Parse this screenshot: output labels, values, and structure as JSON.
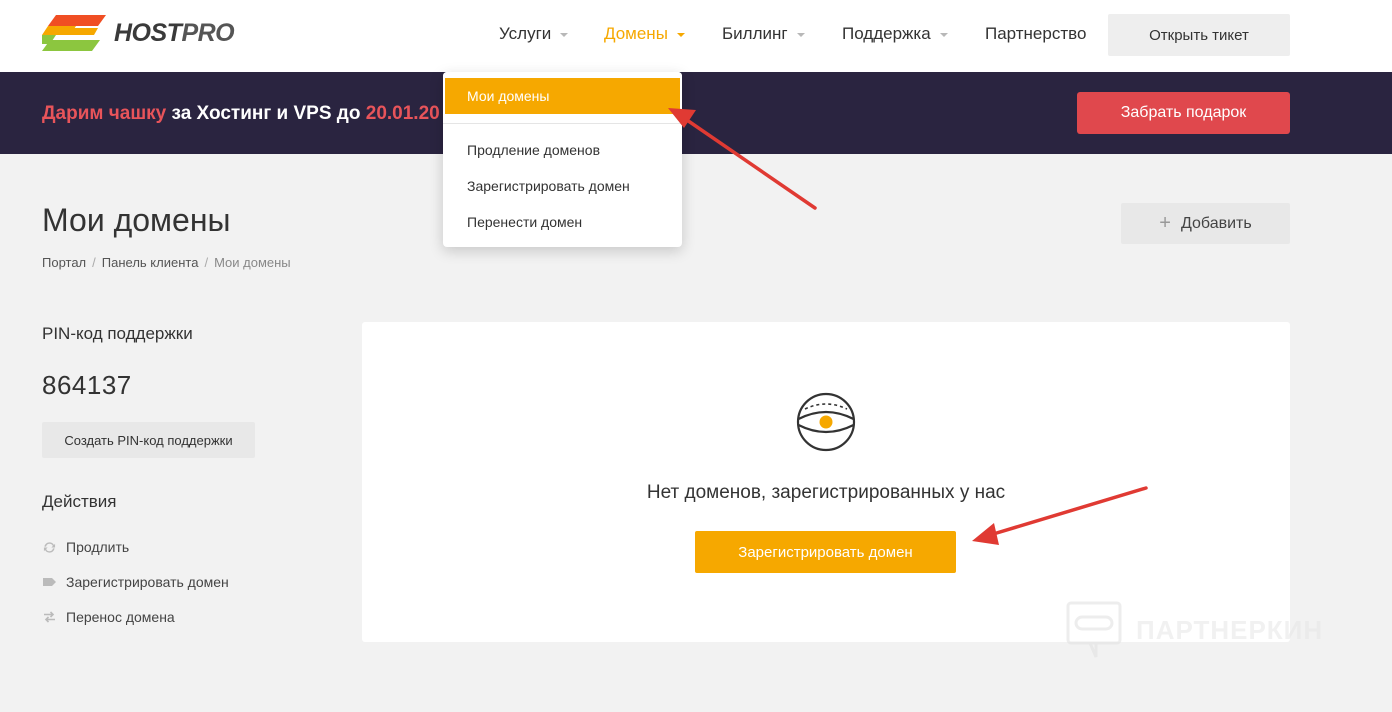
{
  "brand": {
    "name_part1": "HOST",
    "name_part2": "PRO",
    "logo_colors": [
      "#f04e23",
      "#f6a800",
      "#8cc63f"
    ]
  },
  "nav": {
    "items": [
      {
        "label": "Услуги",
        "has_caret": true
      },
      {
        "label": "Домены",
        "has_caret": true,
        "active": true
      },
      {
        "label": "Биллинг",
        "has_caret": true
      },
      {
        "label": "Поддержка",
        "has_caret": true
      },
      {
        "label": "Партнерство",
        "has_caret": false
      }
    ],
    "ticket_button": "Открыть тикет"
  },
  "dropdown": {
    "items": [
      {
        "label": "Мои домены",
        "active": true
      },
      {
        "label": "Продление доменов"
      },
      {
        "label": "Зарегистрировать домен"
      },
      {
        "label": "Перенести домен"
      }
    ]
  },
  "promo": {
    "highlight": "Дарим чашку",
    "text": " за Хостинг и VPS до ",
    "date": "20.01.20",
    "button": "Забрать подарок"
  },
  "page": {
    "title": "Мои домены",
    "breadcrumb": [
      "Портал",
      "Панель клиента",
      "Мои домены"
    ],
    "add_button": "Добавить"
  },
  "sidebar": {
    "pin_heading": "PIN-код поддержки",
    "pin_value": "864137",
    "pin_button": "Создать PIN-код поддержки",
    "actions_heading": "Действия",
    "actions": [
      {
        "label": "Продлить",
        "icon": "refresh-icon"
      },
      {
        "label": "Зарегистрировать домен",
        "icon": "tag-icon"
      },
      {
        "label": "Перенос домена",
        "icon": "transfer-icon"
      }
    ]
  },
  "main": {
    "empty_text": "Нет доменов, зарегистрированных у нас",
    "register_button": "Зарегистрировать домен"
  },
  "watermark": {
    "text": "ПАРТНЕРКИН"
  },
  "colors": {
    "accent": "#f6a800",
    "promo_bg": "#2a2440",
    "promo_highlight": "#e8545a",
    "gift_button": "#e0484d",
    "annotation_arrow": "#e03a33"
  }
}
